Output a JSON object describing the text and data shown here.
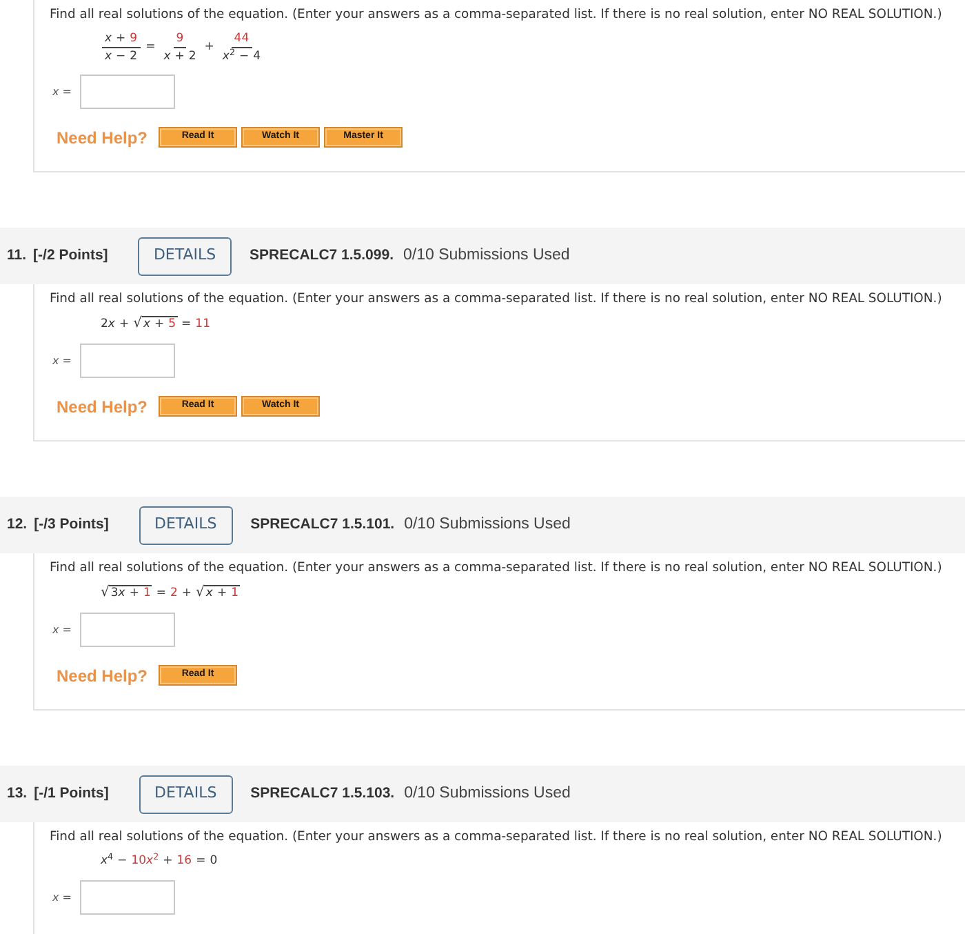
{
  "problems": [
    {
      "prompt": "Find all real solutions of the equation. (Enter your answers as a comma-separated list. If there is no real solution, enter NO REAL SOLUTION.)",
      "equation": [
        {
          "kind": "frac",
          "numerator": [
            {
              "kind": "term",
              "variable": "x"
            },
            {
              "kind": "op",
              "text": "+"
            },
            {
              "kind": "param",
              "text": "9"
            }
          ],
          "denominator": [
            {
              "kind": "term",
              "variable": "x"
            },
            {
              "kind": "op",
              "text": "−"
            },
            {
              "kind": "term",
              "text": "2"
            }
          ]
        },
        {
          "kind": "op",
          "text": "="
        },
        {
          "kind": "frac",
          "numerator": [
            {
              "kind": "param",
              "text": "9"
            }
          ],
          "denominator": [
            {
              "kind": "term",
              "variable": "x"
            },
            {
              "kind": "op",
              "text": "+"
            },
            {
              "kind": "term",
              "text": "2"
            }
          ]
        },
        {
          "kind": "op",
          "text": "+"
        },
        {
          "kind": "frac",
          "numerator": [
            {
              "kind": "param",
              "text": "44"
            }
          ],
          "denominator": [
            {
              "kind": "term",
              "variable": "x",
              "exponent": "2"
            },
            {
              "kind": "op",
              "text": "−"
            },
            {
              "kind": "term",
              "text": "4"
            }
          ]
        }
      ],
      "answer_label": "*x* =",
      "help_label": "Need Help?",
      "help_buttons": [
        "Read It",
        "Watch It",
        "Master It"
      ]
    },
    {
      "header": {
        "number": "11.",
        "points": "[-/2 Points]",
        "details_button": "DETAILS",
        "code": "SPRECALC7 1.5.099.",
        "submissions": "0/10 Submissions Used"
      },
      "prompt": "Find all real solutions of the equation. (Enter your answers as a comma-separated list. If there is no real solution, enter NO REAL SOLUTION.)",
      "equation": [
        {
          "kind": "term",
          "text": "2",
          "variable": "x"
        },
        {
          "kind": "op",
          "text": "+"
        },
        {
          "kind": "sqrt",
          "symbol": "√",
          "radicand": [
            {
              "kind": "term",
              "variable": "x"
            },
            {
              "kind": "op",
              "text": "+"
            },
            {
              "kind": "param",
              "text": "5"
            }
          ]
        },
        {
          "kind": "op",
          "text": "="
        },
        {
          "kind": "param",
          "text": "11"
        }
      ],
      "answer_label": "*x* =",
      "help_label": "Need Help?",
      "help_buttons": [
        "Read It",
        "Watch It"
      ]
    },
    {
      "header": {
        "number": "12.",
        "points": "[-/3 Points]",
        "details_button": "DETAILS",
        "code": "SPRECALC7 1.5.101.",
        "submissions": "0/10 Submissions Used"
      },
      "prompt": "Find all real solutions of the equation. (Enter your answers as a comma-separated list. If there is no real solution, enter NO REAL SOLUTION.)",
      "equation": [
        {
          "kind": "sqrt",
          "symbol": "√",
          "radicand": [
            {
              "kind": "term",
              "text": "3",
              "variable": "x"
            },
            {
              "kind": "op",
              "text": "+"
            },
            {
              "kind": "param",
              "text": "1"
            }
          ]
        },
        {
          "kind": "op",
          "text": "="
        },
        {
          "kind": "param",
          "text": "2"
        },
        {
          "kind": "op",
          "text": "+"
        },
        {
          "kind": "sqrt",
          "symbol": "√",
          "radicand": [
            {
              "kind": "term",
              "variable": "x"
            },
            {
              "kind": "op",
              "text": "+"
            },
            {
              "kind": "param",
              "text": "1"
            }
          ]
        }
      ],
      "answer_label": "*x* =",
      "help_label": "Need Help?",
      "help_buttons": [
        "Read It"
      ]
    },
    {
      "header": {
        "number": "13.",
        "points": "[-/1 Points]",
        "details_button": "DETAILS",
        "code": "SPRECALC7 1.5.103.",
        "submissions": "0/10 Submissions Used"
      },
      "prompt": "Find all real solutions of the equation. (Enter your answers as a comma-separated list. If there is no real solution, enter NO REAL SOLUTION.)",
      "equation": [
        {
          "kind": "term",
          "variable": "x",
          "exponent": "4"
        },
        {
          "kind": "op",
          "text": "−"
        },
        {
          "kind": "param",
          "text": "10",
          "variable": "x",
          "exponent": "2"
        },
        {
          "kind": "op",
          "text": "+"
        },
        {
          "kind": "param",
          "text": "16"
        },
        {
          "kind": "op",
          "text": "="
        },
        {
          "kind": "term",
          "text": "0"
        }
      ],
      "answer_label": "*x* ="
    }
  ]
}
